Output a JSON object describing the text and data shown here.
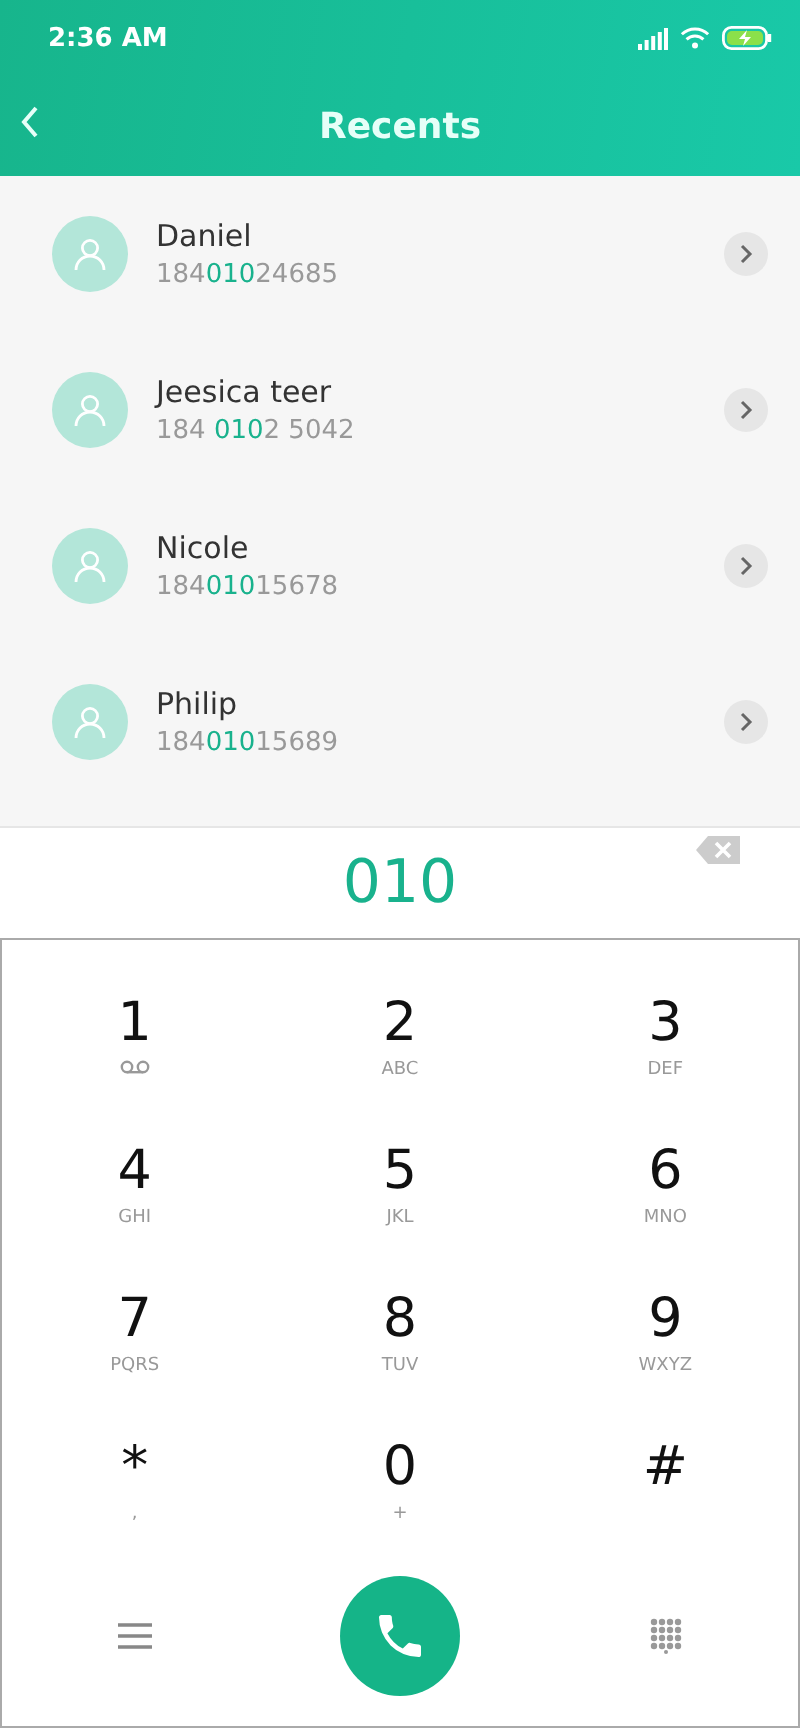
{
  "status_bar": {
    "time": "2:36 AM"
  },
  "header": {
    "title": "Recents"
  },
  "contacts": [
    {
      "name": "Daniel",
      "number": [
        {
          "text": "184",
          "match": false
        },
        {
          "text": "010",
          "match": true
        },
        {
          "text": "24685",
          "match": false
        }
      ]
    },
    {
      "name": "Jeesica teer",
      "number": [
        {
          "text": "184 ",
          "match": false
        },
        {
          "text": "010",
          "match": true
        },
        {
          "text": "2 5042",
          "match": false
        }
      ]
    },
    {
      "name": "Nicole",
      "number": [
        {
          "text": "184",
          "match": false
        },
        {
          "text": "010",
          "match": true
        },
        {
          "text": "15678",
          "match": false
        }
      ]
    },
    {
      "name": "Philip",
      "number": [
        {
          "text": "184",
          "match": false
        },
        {
          "text": "010",
          "match": true
        },
        {
          "text": "15689",
          "match": false
        }
      ]
    }
  ],
  "dialed": "010",
  "keypad": [
    {
      "digit": "1",
      "kind": "voicemail"
    },
    {
      "digit": "2",
      "letters": "ABC",
      "kind": "letters"
    },
    {
      "digit": "3",
      "letters": "DEF",
      "kind": "letters"
    },
    {
      "digit": "4",
      "letters": "GHI",
      "kind": "letters"
    },
    {
      "digit": "5",
      "letters": "JKL",
      "kind": "letters"
    },
    {
      "digit": "6",
      "letters": "MNO",
      "kind": "letters"
    },
    {
      "digit": "7",
      "letters": "PQRS",
      "kind": "letters"
    },
    {
      "digit": "8",
      "letters": "TUV",
      "kind": "letters"
    },
    {
      "digit": "9",
      "letters": "WXYZ",
      "kind": "letters"
    },
    {
      "digit": "*",
      "letters": ",",
      "kind": "letters"
    },
    {
      "digit": "0",
      "letters": "+",
      "kind": "letters"
    },
    {
      "digit": "#",
      "kind": "plain"
    }
  ]
}
